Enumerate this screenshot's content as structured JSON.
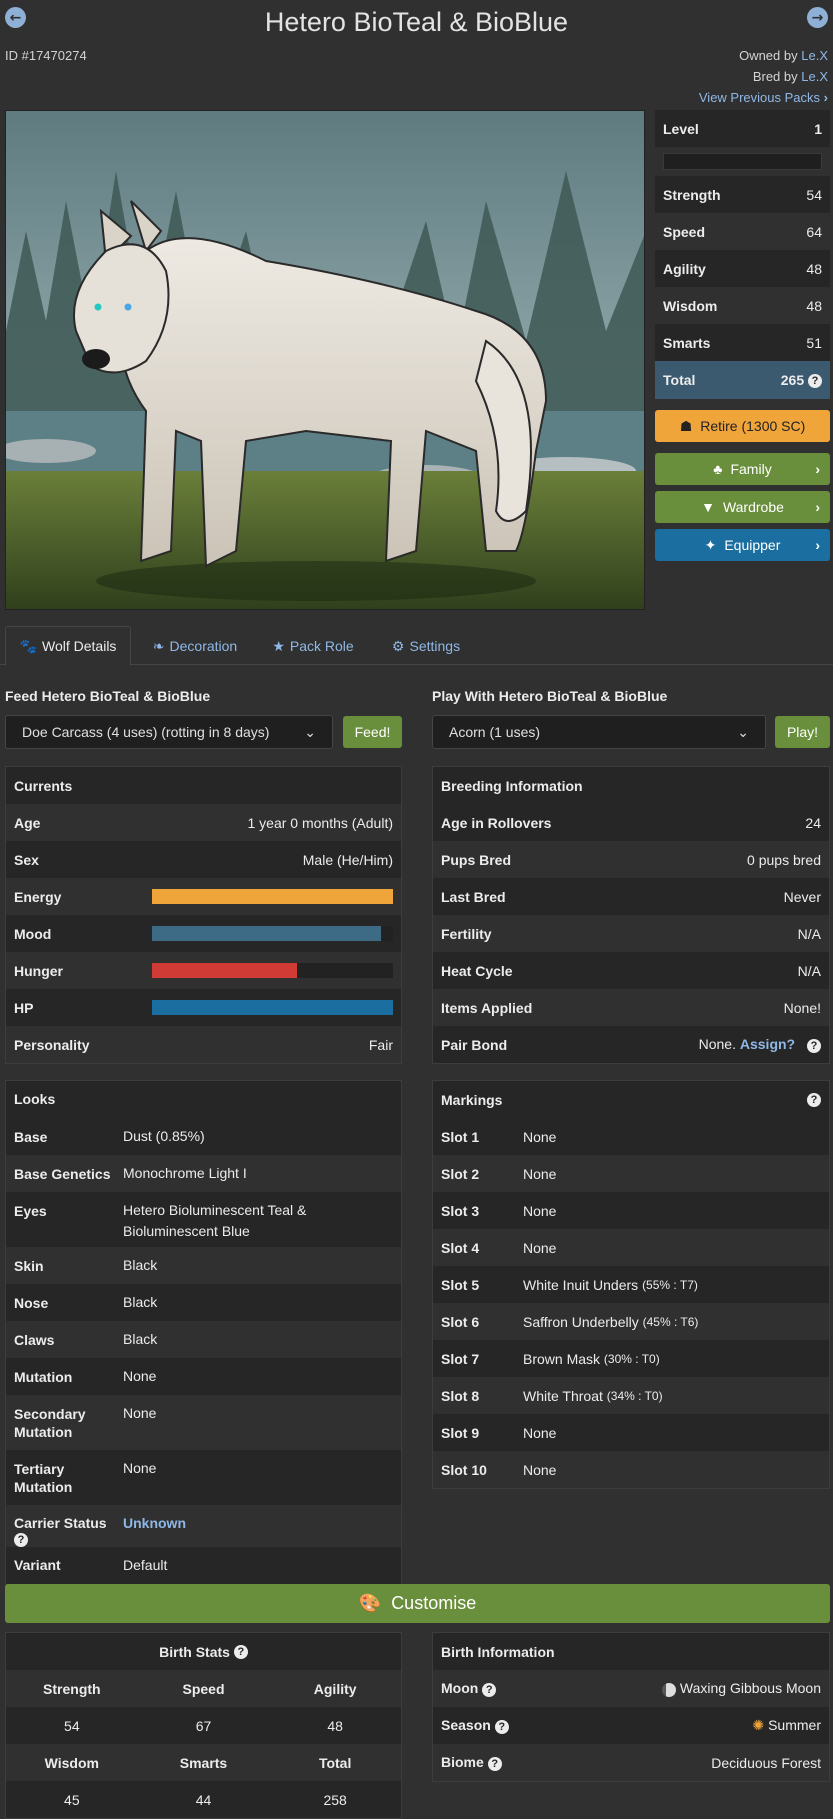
{
  "header": {
    "title": "Hetero BioTeal & BioBlue",
    "id_text": "ID #17470274",
    "owned_label": "Owned by",
    "owner": "Le.X",
    "bred_label": "Bred by",
    "breeder": "Le.X",
    "prev_packs": "View Previous Packs"
  },
  "stats": {
    "level_label": "Level",
    "level": "1",
    "level_progress": 0,
    "rows": [
      {
        "label": "Strength",
        "value": "54"
      },
      {
        "label": "Speed",
        "value": "64"
      },
      {
        "label": "Agility",
        "value": "48"
      },
      {
        "label": "Wisdom",
        "value": "48"
      },
      {
        "label": "Smarts",
        "value": "51"
      }
    ],
    "total_label": "Total",
    "total": "265"
  },
  "actions": {
    "retire": "Retire (1300 SC)",
    "family": "Family",
    "wardrobe": "Wardrobe",
    "equipper": "Equipper"
  },
  "tabs": [
    "Wolf Details",
    "Decoration",
    "Pack Role",
    "Settings"
  ],
  "feed": {
    "heading": "Feed Hetero BioTeal & BioBlue",
    "selected": "Doe Carcass (4 uses) (rotting in 8 days)",
    "button": "Feed!"
  },
  "play": {
    "heading": "Play With Hetero BioTeal & BioBlue",
    "selected": "Acorn (1 uses)",
    "button": "Play!"
  },
  "currents": {
    "heading": "Currents",
    "age_label": "Age",
    "age": "1 year 0 months (Adult)",
    "sex_label": "Sex",
    "sex": "Male (He/Him)",
    "energy_label": "Energy",
    "energy": 1.0,
    "mood_label": "Mood",
    "mood": 0.95,
    "hunger_label": "Hunger",
    "hunger": 0.6,
    "hp_label": "HP",
    "hp": 1.0,
    "personality_label": "Personality",
    "personality": "Fair"
  },
  "breeding": {
    "heading": "Breeding Information",
    "rows": [
      {
        "label": "Age in Rollovers",
        "value": "24"
      },
      {
        "label": "Pups Bred",
        "value": "0 pups bred"
      },
      {
        "label": "Last Bred",
        "value": "Never"
      },
      {
        "label": "Fertility",
        "value": "N/A"
      },
      {
        "label": "Heat Cycle",
        "value": "N/A"
      },
      {
        "label": "Items Applied",
        "value": "None!"
      }
    ],
    "pair_label": "Pair Bond",
    "pair_value": "None.",
    "pair_link": "Assign?"
  },
  "looks": {
    "heading": "Looks",
    "rows": [
      {
        "label": "Base",
        "value": "Dust (0.85%)"
      },
      {
        "label": "Base Genetics",
        "value": "Monochrome Light I"
      },
      {
        "label": "Eyes",
        "value": "Hetero Bioluminescent Teal & Bioluminescent Blue"
      },
      {
        "label": "Skin",
        "value": "Black"
      },
      {
        "label": "Nose",
        "value": "Black"
      },
      {
        "label": "Claws",
        "value": "Black"
      },
      {
        "label": "Mutation",
        "value": "None"
      },
      {
        "label": "Secondary Mutation",
        "value": "None"
      },
      {
        "label": "Tertiary Mutation",
        "value": "None"
      }
    ],
    "carrier_label": "Carrier Status",
    "carrier_value": "Unknown",
    "variant_label": "Variant",
    "variant_value": "Default"
  },
  "markings": {
    "heading": "Markings",
    "slots": [
      {
        "label": "Slot 1",
        "value": "None",
        "detail": ""
      },
      {
        "label": "Slot 2",
        "value": "None",
        "detail": ""
      },
      {
        "label": "Slot 3",
        "value": "None",
        "detail": ""
      },
      {
        "label": "Slot 4",
        "value": "None",
        "detail": ""
      },
      {
        "label": "Slot 5",
        "value": "White Inuit Unders",
        "detail": "(55% : T7)"
      },
      {
        "label": "Slot 6",
        "value": "Saffron Underbelly",
        "detail": "(45% : T6)"
      },
      {
        "label": "Slot 7",
        "value": "Brown Mask",
        "detail": "(30% : T0)"
      },
      {
        "label": "Slot 8",
        "value": "White Throat",
        "detail": "(34% : T0)"
      },
      {
        "label": "Slot 9",
        "value": "None",
        "detail": ""
      },
      {
        "label": "Slot 10",
        "value": "None",
        "detail": ""
      }
    ]
  },
  "customise": {
    "label": "Customise"
  },
  "birth_stats": {
    "heading": "Birth Stats",
    "h1": [
      "Strength",
      "Speed",
      "Agility"
    ],
    "v1": [
      "54",
      "67",
      "48"
    ],
    "h2": [
      "Wisdom",
      "Smarts",
      "Total"
    ],
    "v2": [
      "45",
      "44",
      "258"
    ]
  },
  "birth_info": {
    "heading": "Birth Information",
    "moon_label": "Moon",
    "moon": "Waxing Gibbous Moon",
    "season_label": "Season",
    "season": "Summer",
    "biome_label": "Biome",
    "biome": "Deciduous Forest"
  },
  "colors": {
    "energy": "#f0a53a",
    "mood": "#3d6a85",
    "hunger": "#d03b35",
    "hp": "#1a6fa0",
    "retire": "#f0a53a",
    "green": "#6a8f3c",
    "equipper": "#1a6fa0",
    "total_row": "#3b5a70"
  }
}
